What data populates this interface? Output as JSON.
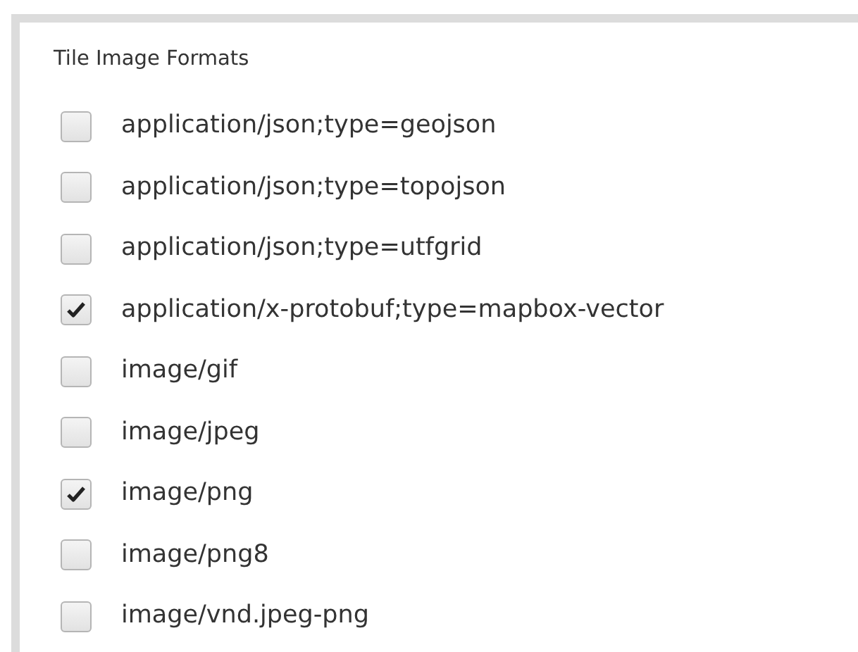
{
  "panel": {
    "title": "Tile Image Formats",
    "options": [
      {
        "label": "application/json;type=geojson",
        "checked": false
      },
      {
        "label": "application/json;type=topojson",
        "checked": false
      },
      {
        "label": "application/json;type=utfgrid",
        "checked": false
      },
      {
        "label": "application/x-protobuf;type=mapbox-vector",
        "checked": true
      },
      {
        "label": "image/gif",
        "checked": false
      },
      {
        "label": "image/jpeg",
        "checked": false
      },
      {
        "label": "image/png",
        "checked": true
      },
      {
        "label": "image/png8",
        "checked": false
      },
      {
        "label": "image/vnd.jpeg-png",
        "checked": false
      }
    ]
  }
}
